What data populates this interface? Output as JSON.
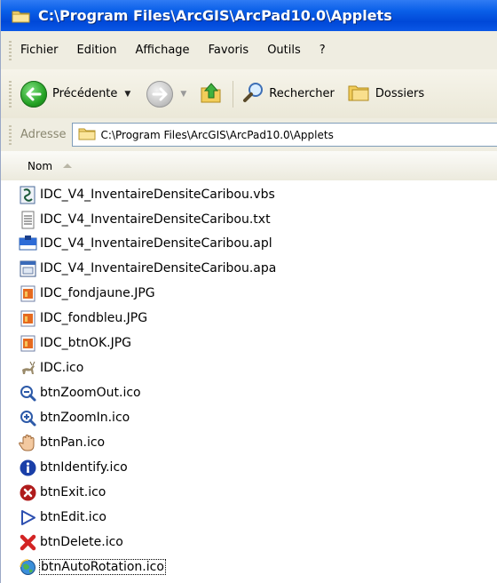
{
  "window": {
    "title": "C:\\Program Files\\ArcGIS\\ArcPad10.0\\Applets"
  },
  "menu": {
    "items": [
      "Fichier",
      "Edition",
      "Affichage",
      "Favoris",
      "Outils",
      "?"
    ]
  },
  "toolbar": {
    "back_label": "Précédente",
    "search_label": "Rechercher",
    "folders_label": "Dossiers"
  },
  "address": {
    "label": "Adresse",
    "path": "C:\\Program Files\\ArcGIS\\ArcPad10.0\\Applets"
  },
  "columns": {
    "name_header": "Nom"
  },
  "files": [
    {
      "name": "IDC_V4_InventaireDensiteCaribou.vbs",
      "icon": "vbs-script-icon"
    },
    {
      "name": "IDC_V4_InventaireDensiteCaribou.txt",
      "icon": "text-document-icon"
    },
    {
      "name": "IDC_V4_InventaireDensiteCaribou.apl",
      "icon": "apl-file-icon"
    },
    {
      "name": "IDC_V4_InventaireDensiteCaribou.apa",
      "icon": "apa-file-icon"
    },
    {
      "name": "IDC_fondjaune.JPG",
      "icon": "jpg-image-icon"
    },
    {
      "name": "IDC_fondbleu.JPG",
      "icon": "jpg-image-icon"
    },
    {
      "name": "IDC_btnOK.JPG",
      "icon": "jpg-image-icon"
    },
    {
      "name": "IDC.ico",
      "icon": "caribou-icon"
    },
    {
      "name": "btnZoomOut.ico",
      "icon": "zoom-out-icon"
    },
    {
      "name": "btnZoomIn.ico",
      "icon": "zoom-in-icon"
    },
    {
      "name": "btnPan.ico",
      "icon": "pan-hand-icon"
    },
    {
      "name": "btnIdentify.ico",
      "icon": "info-icon"
    },
    {
      "name": "btnExit.ico",
      "icon": "exit-icon"
    },
    {
      "name": "btnEdit.ico",
      "icon": "edit-arrow-icon"
    },
    {
      "name": "btnDelete.ico",
      "icon": "delete-x-icon"
    },
    {
      "name": "btnAutoRotation.ico",
      "icon": "globe-rotation-icon"
    }
  ]
}
